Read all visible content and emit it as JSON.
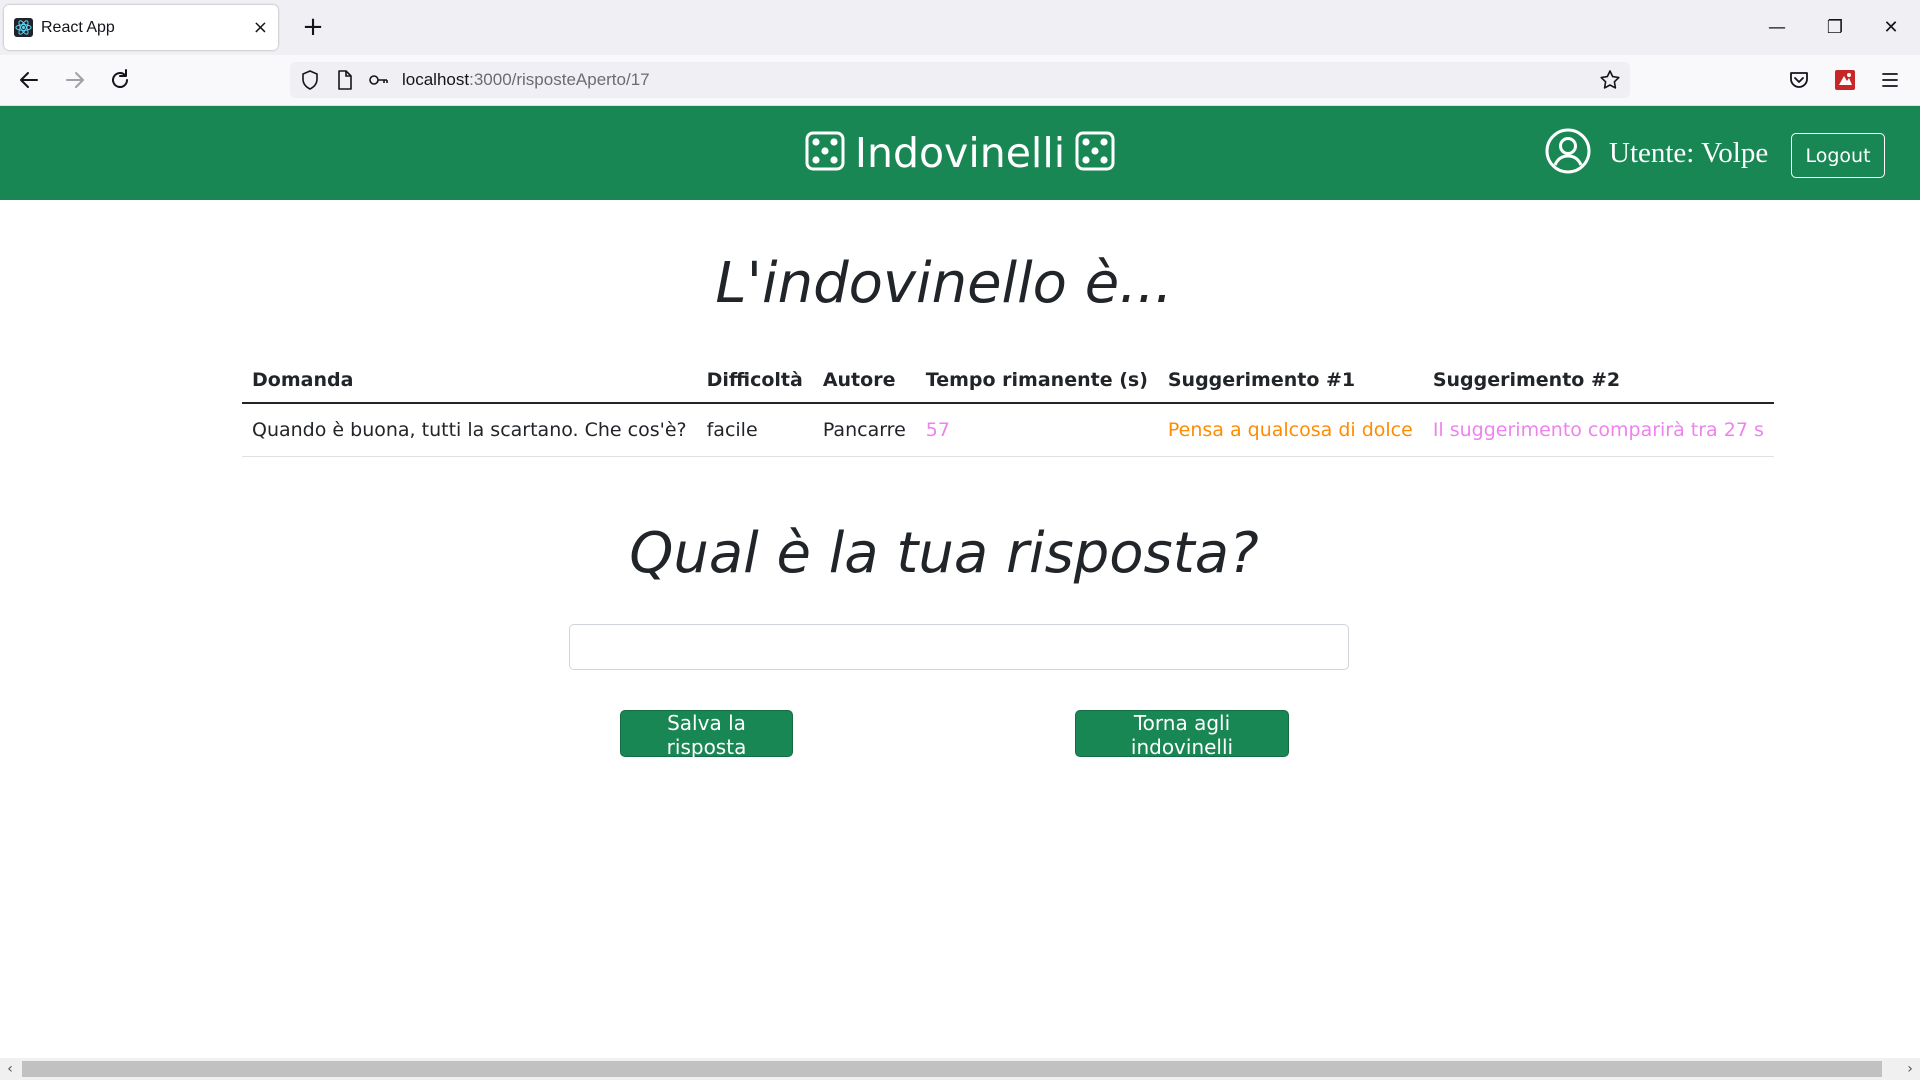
{
  "browser": {
    "tab_title": "React App",
    "tab_close": "×",
    "new_tab": "+",
    "url_host": "localhost",
    "url_path": ":3000/risposteAperto/17",
    "window_minimize": "—",
    "window_restore": "❐",
    "window_close": "✕"
  },
  "header": {
    "brand": "Indovinelli",
    "user_label": "Utente: Volpe",
    "logout_label": "Logout"
  },
  "main": {
    "title": "L'indovinello è...",
    "table": {
      "columns": [
        "Domanda",
        "Difficoltà",
        "Autore",
        "Tempo rimanente (s)",
        "Suggerimento #1",
        "Suggerimento #2"
      ],
      "rows": [
        {
          "domanda": "Quando è buona, tutti la scartano. Che cos'è?",
          "difficolta": "facile",
          "autore": "Pancarre",
          "tempo": "57",
          "suggerimento1": "Pensa a qualcosa di dolce",
          "suggerimento2": "Il suggerimento comparirà tra 27 s"
        }
      ]
    },
    "answer_title": "Qual è la tua risposta?",
    "answer_value": "",
    "save_label": "Salva la risposta",
    "back_label": "Torna agli indovinelli"
  },
  "colors": {
    "brand_green": "#198754",
    "time_color": "#ee82ee",
    "hint1_color": "#ff8c00",
    "hint2_color": "#ee82ee"
  }
}
